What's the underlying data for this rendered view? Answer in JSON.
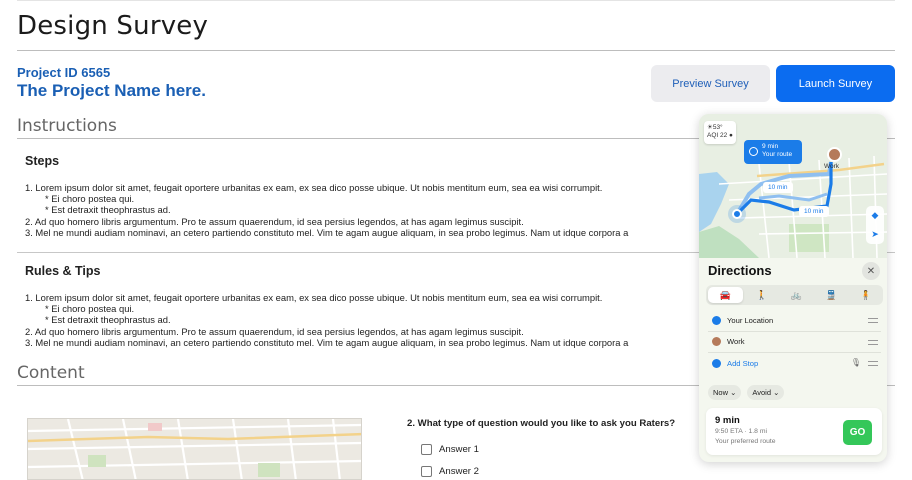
{
  "page": {
    "title": "Design Survey",
    "project_id": "Project ID 6565",
    "project_name": "The Project Name here."
  },
  "actions": {
    "preview_label": "Preview Survey",
    "launch_label": "Launch Survey"
  },
  "instructions": {
    "title": "Instructions",
    "steps": {
      "title": "Steps",
      "items": [
        "1. Lorem ipsum dolor sit amet, feugait oportere urbanitas ex eam, ex sea dico posse ubique. Ut nobis mentitum eum, sea ea wisi corrumpit.",
        "* Ei choro postea qui.",
        "* Est detraxit theophrastus ad.",
        "2. Ad quo homero libris argumentum. Pro te assum quaerendum, id sea persius legendos, at has agam legimus suscipit.",
        "3. Mel ne mundi audiam nominavi, an cetero partiendo constituto mel. Vim te agam augue aliquam, in sea probo legimus. Nam ut idque corpora a"
      ]
    },
    "rules": {
      "title": "Rules & Tips",
      "items": [
        "1. Lorem ipsum dolor sit amet, feugait oportere urbanitas ex eam, ex sea dico posse ubique. Ut nobis mentitum eum, sea ea wisi corrumpit.",
        "* Ei choro postea qui.",
        "* Est detraxit theophrastus ad.",
        "2. Ad quo homero libris argumentum. Pro te assum quaerendum, id sea persius legendos, at has agam legimus suscipit.",
        "3. Mel ne mundi audiam nominavi, an cetero partiendo constituto mel. Vim te agam augue aliquam, in sea probo legimus. Nam ut idque corpora a"
      ]
    }
  },
  "content": {
    "title": "Content",
    "question": "2. What type of question would you like to ask you Raters?",
    "answers": [
      "Answer 1",
      "Answer 2"
    ]
  },
  "directions": {
    "weather_temp": "☀53°",
    "weather_aqi": "AQI 22 ●",
    "route_chip_time": "9 min",
    "route_chip_label": "Your route",
    "time_chip_a": "10 min",
    "time_chip_b": "10 min",
    "work_label": "Work",
    "title": "Directions",
    "close_glyph": "✕",
    "modes": [
      "🚘",
      "🚶",
      "🚲",
      "🚆",
      "🧍"
    ],
    "stops": [
      "Your Location",
      "Work",
      "Add Stop"
    ],
    "options": [
      "Now ⌄",
      "Avoid ⌄"
    ],
    "route_time": "9 min",
    "route_eta": "9:50 ETA · 1.8 mi",
    "route_note": "Your preferred route",
    "go_label": "GO",
    "colors": {
      "accent": "#1b7ce8",
      "go": "#34c759",
      "work_pin": "#b57a5a"
    }
  },
  "colors": {
    "link": "#1a5fb4",
    "primary_button": "#0b6cf0",
    "secondary_button": "#ececef"
  }
}
